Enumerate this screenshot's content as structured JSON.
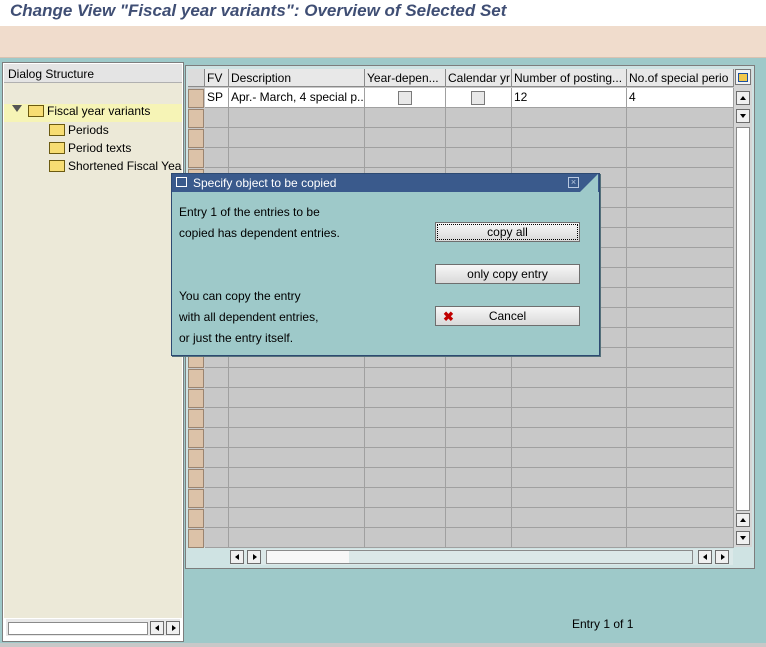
{
  "window": {
    "title": "Change View \"Fiscal year variants\": Overview of Selected Set"
  },
  "tree": {
    "header": "Dialog Structure",
    "items": [
      {
        "label": "Fiscal year variants",
        "expanded": true,
        "selected": true
      },
      {
        "label": "Periods"
      },
      {
        "label": "Period texts"
      },
      {
        "label": "Shortened Fiscal Years"
      }
    ]
  },
  "table": {
    "columns": [
      "FV",
      "Description",
      "Year-depen...",
      "Calendar yr",
      "Number of posting...",
      "No.of special perio"
    ],
    "rows": [
      {
        "fv": "SP",
        "description": "Apr.- March, 4 special p...",
        "year_dependent": false,
        "calendar_year": false,
        "posting_periods": "12",
        "special_periods": "4"
      }
    ]
  },
  "status": {
    "entry": "Entry 1 of 1"
  },
  "dialog": {
    "title": "Specify object to be copied",
    "message_line1": "Entry  1  of the entries to be",
    "message_line2": "copied has dependent entries.",
    "hint_line1": "You can copy the entry",
    "hint_line2": "with all dependent entries,",
    "hint_line3": "or just the entry itself.",
    "buttons": {
      "copy_all": "copy all",
      "only_copy_entry": "only copy entry",
      "cancel": "Cancel"
    }
  },
  "icons": {
    "tree_folder": "folder-icon",
    "expand": "triangle-down-icon",
    "table_settings": "table-settings-icon",
    "dialog_close": "close-icon",
    "cancel": "cancel-x-icon"
  },
  "colors": {
    "title_text": "#3f4e74",
    "toolbar_bg": "#f0dccc",
    "content_bg": "#9ec9c9",
    "dialog_title_bg": "#3a5a8c",
    "tree_selected_bg": "#f6f4b6",
    "cancel_icon": "#c00000"
  }
}
